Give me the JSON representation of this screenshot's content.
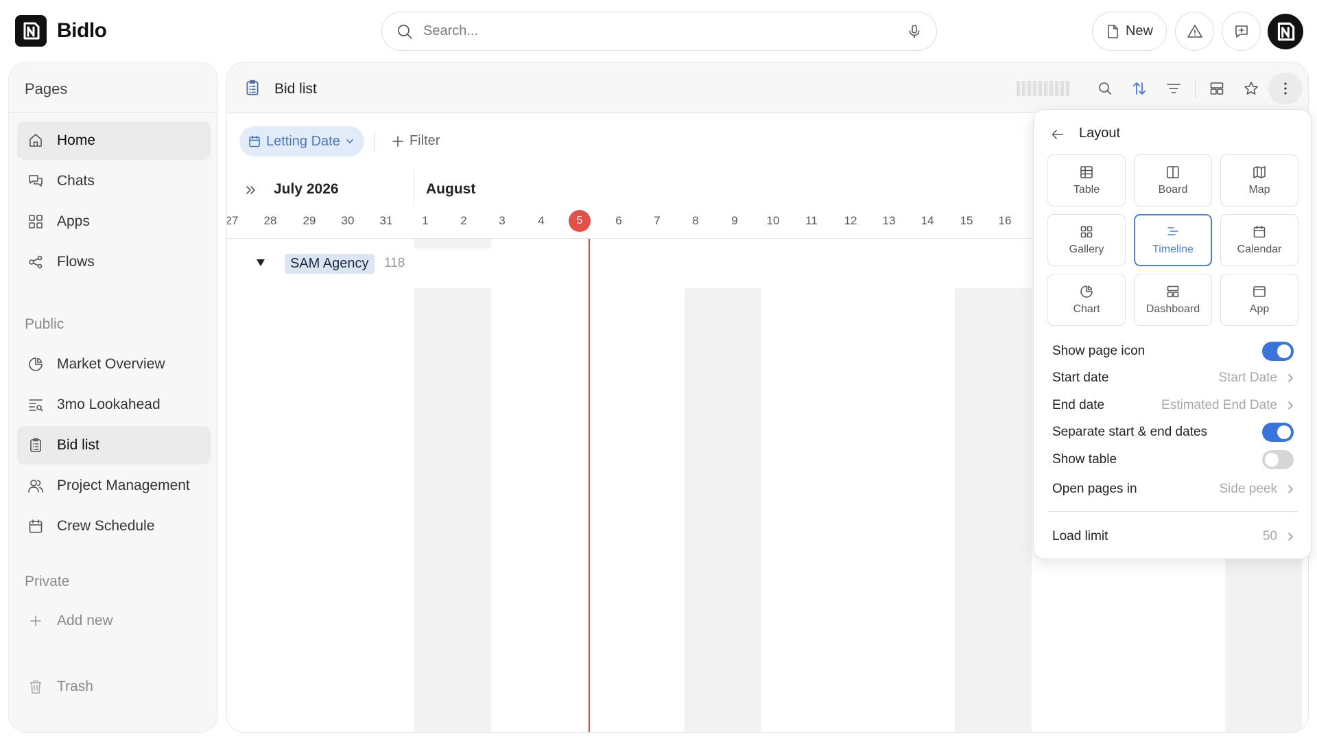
{
  "app": {
    "name": "Bidlo"
  },
  "search": {
    "placeholder": "Search..."
  },
  "topbar": {
    "new_label": "New"
  },
  "sidebar": {
    "title": "Pages",
    "items": [
      {
        "label": "Home",
        "icon": "home-icon"
      },
      {
        "label": "Chats",
        "icon": "chat-icon"
      },
      {
        "label": "Apps",
        "icon": "apps-icon"
      },
      {
        "label": "Flows",
        "icon": "flows-icon"
      }
    ],
    "public_label": "Public",
    "public_items": [
      {
        "label": "Market Overview",
        "icon": "pie-icon"
      },
      {
        "label": "3mo Lookahead",
        "icon": "timeline-list-icon"
      },
      {
        "label": "Bid list",
        "icon": "clipboard-icon"
      },
      {
        "label": "Project Management",
        "icon": "users-icon"
      },
      {
        "label": "Crew Schedule",
        "icon": "calendar-icon"
      }
    ],
    "private_label": "Private",
    "add_new": "Add new",
    "trash": "Trash"
  },
  "main": {
    "title": "Bid list",
    "chip_label": "Letting Date",
    "filter_label": "Filter"
  },
  "timeline": {
    "month1": "July 2026",
    "month2": "August",
    "days": [
      "27",
      "28",
      "29",
      "30",
      "31",
      "1",
      "2",
      "3",
      "4",
      "5",
      "6",
      "7",
      "8",
      "9",
      "10",
      "11",
      "12",
      "13",
      "14",
      "15",
      "16"
    ],
    "today": "5",
    "group": {
      "label": "SAM Agency",
      "count": "118"
    }
  },
  "layout_panel": {
    "title": "Layout",
    "tiles": [
      {
        "label": "Table",
        "icon": "table-icon"
      },
      {
        "label": "Board",
        "icon": "board-icon"
      },
      {
        "label": "Map",
        "icon": "map-icon"
      },
      {
        "label": "Gallery",
        "icon": "gallery-icon"
      },
      {
        "label": "Timeline",
        "icon": "timeline-icon"
      },
      {
        "label": "Calendar",
        "icon": "calendar-icon"
      },
      {
        "label": "Chart",
        "icon": "chart-icon"
      },
      {
        "label": "Dashboard",
        "icon": "dashboard-icon"
      },
      {
        "label": "App",
        "icon": "app-icon"
      }
    ],
    "selected_tile": "Timeline",
    "rows": {
      "show_page_icon": {
        "label": "Show page icon",
        "on": true
      },
      "start_date": {
        "label": "Start date",
        "value": "Start Date"
      },
      "end_date": {
        "label": "End date",
        "value": "Estimated End Date"
      },
      "separate_dates": {
        "label": "Separate start & end dates",
        "on": true
      },
      "show_table": {
        "label": "Show table",
        "on": false
      },
      "open_pages_in": {
        "label": "Open pages in",
        "value": "Side peek"
      },
      "load_limit": {
        "label": "Load limit",
        "value": "50"
      }
    }
  },
  "colors": {
    "accent": "#3a73d9",
    "today": "#e05248",
    "chip_bg": "#e2ebf8"
  }
}
